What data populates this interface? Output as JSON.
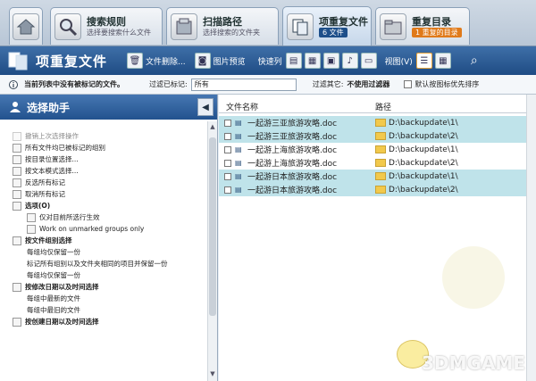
{
  "tabs": [
    {
      "title": "",
      "subtitle": "",
      "icon": "home-icon"
    },
    {
      "title": "搜索规则",
      "subtitle": "选择要搜索什么文件",
      "icon": "magnifier-icon"
    },
    {
      "title": "扫描路径",
      "subtitle": "选择搜索的文件夹",
      "icon": "scan-folder-icon"
    },
    {
      "title": "项重复文件",
      "subtitle": "",
      "badge": "6 文件",
      "icon": "duplicate-files-icon"
    },
    {
      "title": "重复目录",
      "subtitle": "",
      "badge": "1 重复的目录",
      "icon": "duplicate-folder-icon"
    }
  ],
  "toolbar": {
    "title": "项重复文件",
    "delete_label": "文件删除...",
    "preview_label": "图片预览",
    "quick_label": "快速列",
    "view_label": "视图(V)"
  },
  "filterbar": {
    "hint": "当前列表中没有被标记的文件。",
    "filter_label": "过滤已标记:",
    "filter_value": "所有",
    "other_filter_label": "过滤其它:",
    "other_filter_value": "不使用过滤器",
    "autoselect_label": "默认按图标优先排序"
  },
  "left_panel": {
    "title": "选择助手",
    "items": [
      {
        "label": "撤销上次选择操作",
        "type": "dim"
      },
      {
        "label": "所有文件均已被标记的组别",
        "type": "normal"
      },
      {
        "label": "按目录位置选择...",
        "type": "normal"
      },
      {
        "label": "按文本模式选择...",
        "type": "normal"
      },
      {
        "label": "反选所有标记",
        "type": "normal"
      },
      {
        "label": "取消所有标记",
        "type": "normal"
      },
      {
        "label": "选项(O)",
        "type": "section"
      },
      {
        "label": "仅对目前所选行生效",
        "type": "indent"
      },
      {
        "label": "Work on unmarked groups only",
        "type": "indent"
      },
      {
        "label": "按文件组别选择",
        "type": "section"
      },
      {
        "label": "每组均仅保留一份",
        "type": "sub"
      },
      {
        "label": "标记所有组别以及文件夹相同的项目并保留一份",
        "type": "sub"
      },
      {
        "label": "每组均仅保留一份",
        "type": "sub"
      },
      {
        "label": "按修改日期以及时间选择",
        "type": "section"
      },
      {
        "label": "每组中最新的文件",
        "type": "sub"
      },
      {
        "label": "每组中最旧的文件",
        "type": "sub"
      },
      {
        "label": "按创建日期以及时间选择",
        "type": "section"
      }
    ]
  },
  "right_panel": {
    "col_name": "文件名称",
    "col_path": "路径",
    "rows": [
      {
        "name": "一起游三亚旅游攻略.doc",
        "path": "D:\\backupdate\\1\\",
        "hl": true
      },
      {
        "name": "一起游三亚旅游攻略.doc",
        "path": "D:\\backupdate\\2\\",
        "hl": true
      },
      {
        "name": "一起游上海旅游攻略.doc",
        "path": "D:\\backupdate\\1\\",
        "hl": false
      },
      {
        "name": "一起游上海旅游攻略.doc",
        "path": "D:\\backupdate\\2\\",
        "hl": false
      },
      {
        "name": "一起游日本旅游攻略.doc",
        "path": "D:\\backupdate\\1\\",
        "hl": true
      },
      {
        "name": "一起游日本旅游攻略.doc",
        "path": "D:\\backupdate\\2\\",
        "hl": true
      }
    ]
  },
  "watermark": "3DMGAME",
  "colors": {
    "toolbar": "#1f4c84",
    "highlight_row": "#bfe3ea",
    "accent": "#e07a1a"
  }
}
